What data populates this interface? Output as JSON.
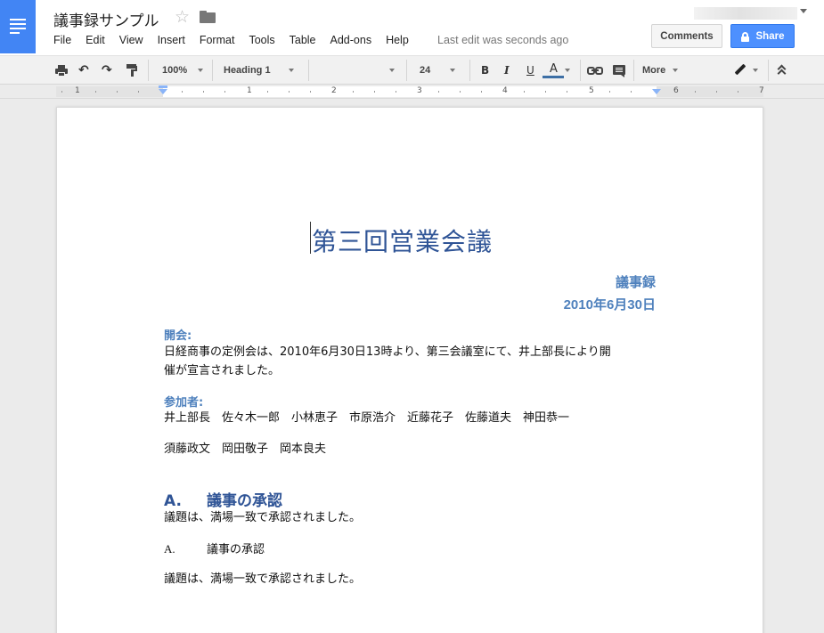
{
  "header": {
    "doc_title": "議事録サンプル",
    "last_edit": "Last edit was seconds ago",
    "comments_label": "Comments",
    "share_label": "Share"
  },
  "menu": [
    "File",
    "Edit",
    "View",
    "Insert",
    "Format",
    "Tools",
    "Table",
    "Add-ons",
    "Help"
  ],
  "toolbar": {
    "zoom": "100%",
    "style": "Heading 1",
    "font": "",
    "font_size": "24",
    "bold": "B",
    "italic": "I",
    "underline": "U",
    "text_color_letter": "A",
    "more": "More",
    "text_color": "#3d6fa5"
  },
  "ruler": {
    "numbers": [
      "1",
      "1",
      "2",
      "3",
      "4",
      "5",
      "6",
      "7"
    ]
  },
  "document": {
    "heading": "第三回営業会議",
    "subtitle": "議事録",
    "date": "2010年6月30日",
    "opening_label": "開会:",
    "opening_text": [
      "日経商事の定例会は、2010年6月30日13時より、第三会議室にて、井上部長により開",
      "催が宣言されました。"
    ],
    "attendees_label": "参加者:",
    "attendees_line1": "井上部長　佐々木一郎　小林恵子　市原浩介　近藤花子　佐藤道夫　神田恭一",
    "attendees_line2": "須藤政文　岡田敬子　岡本良夫",
    "agenda_number": "A.",
    "agenda_title": "議事の承認",
    "agenda_result": "議題は、満場一致で承認されました。",
    "agenda_plain_number": "A.",
    "agenda_plain_title": "議事の承認",
    "agenda_plain_result": "議題は、満場一致で承認されました。"
  },
  "colors": {
    "brand_blue": "#4285f4",
    "share_blue": "#4d90fe",
    "heading_blue": "#2f5496",
    "label_blue": "#4f81bd"
  },
  "icons": [
    "docs-logo-icon",
    "star-icon",
    "folder-icon",
    "lock-icon",
    "print-icon",
    "undo-icon",
    "redo-icon",
    "paint-format-icon",
    "link-icon",
    "comment-icon",
    "pen-icon",
    "collapse-icon"
  ]
}
